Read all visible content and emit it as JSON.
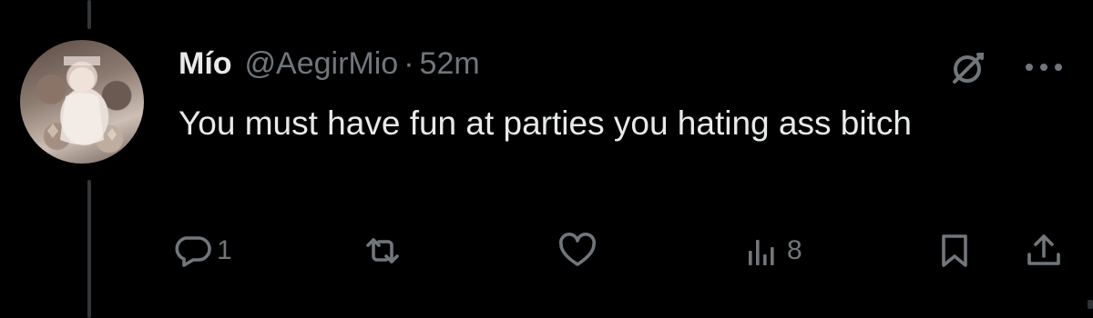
{
  "tweet": {
    "display_name": "Mío",
    "handle": "@AegirMio",
    "separator": "·",
    "time": "52m",
    "text": "You must have fun at parties you hating ass bitch"
  },
  "actions": {
    "replies": "1",
    "reposts": "",
    "likes": "",
    "views": "8"
  },
  "icons": {
    "grok": "grok-slash-circle-icon",
    "more": "more-dots-icon",
    "reply": "reply-bubble-icon",
    "repost": "repost-arrows-icon",
    "like": "heart-icon",
    "views": "bar-chart-icon",
    "bookmark": "bookmark-icon",
    "share": "share-upload-icon"
  },
  "colors": {
    "background": "#000000",
    "primary_text": "#e7e9ea",
    "secondary_text": "#71767b",
    "thread_line": "#333639"
  }
}
